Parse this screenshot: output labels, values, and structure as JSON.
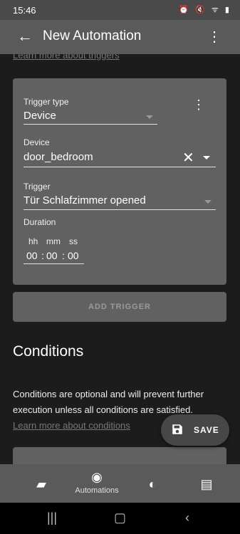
{
  "status_bar": {
    "time": "15:46",
    "icons": "⏰ 🔇 ᯤ ▮"
  },
  "app_bar": {
    "title": "New Automation"
  },
  "triggers": {
    "learn_more": "Learn more about triggers",
    "trigger_type_label": "Trigger type",
    "trigger_type_value": "Device",
    "device_label": "Device",
    "device_value": "door_bedroom",
    "trigger_label": "Trigger",
    "trigger_value": "Tür Schlafzimmer opened",
    "duration_label": "Duration",
    "duration": {
      "hh_label": "hh",
      "mm_label": "mm",
      "ss_label": "ss",
      "hh": "00",
      "mm": "00",
      "ss": "00",
      "sep": ":"
    },
    "add_trigger": "ADD TRIGGER"
  },
  "conditions": {
    "heading": "Conditions",
    "description": "Conditions are optional and will prevent further execution unless all conditions are satisfied.",
    "learn_more": "Learn more about conditions"
  },
  "fab": {
    "label": "SAVE"
  },
  "bottom_nav": {
    "automations_label": "Automations"
  },
  "colors": {
    "card": "#616161",
    "appbar": "#5a5a5a",
    "background": "#1c1c1c"
  }
}
